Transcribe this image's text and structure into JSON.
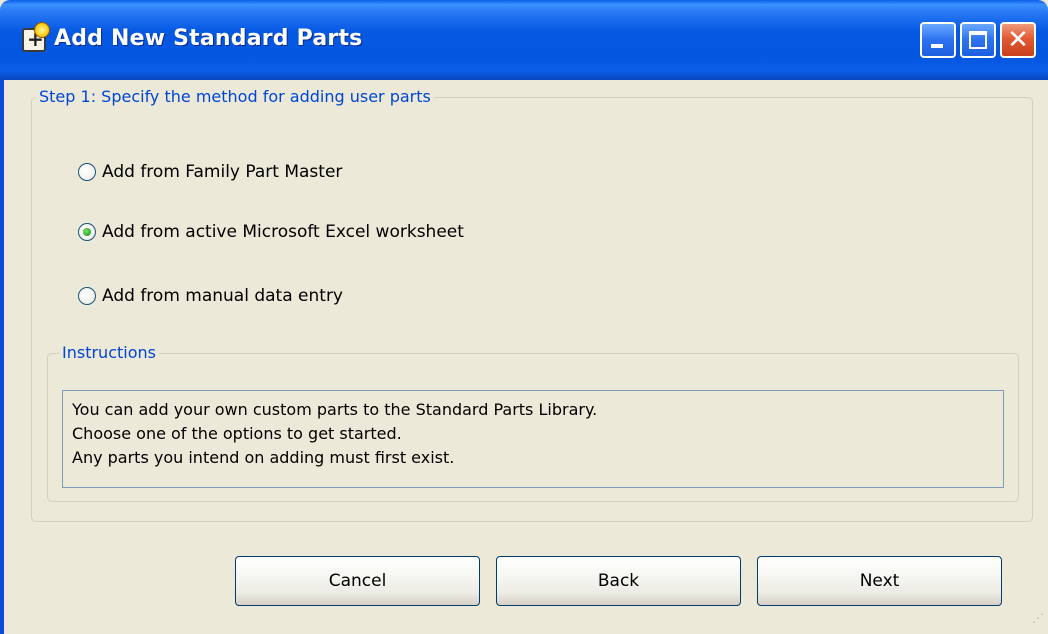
{
  "window": {
    "title": "Add New Standard Parts",
    "title_icon": "add-part-icon",
    "controls": {
      "minimize_icon": "minimize-icon",
      "maximize_icon": "maximize-icon",
      "close_icon": "close-icon",
      "close_glyph": "✕"
    }
  },
  "step": {
    "legend": "Step 1: Specify the method for adding user parts",
    "options": [
      {
        "label": "Add from Family Part Master",
        "checked": false
      },
      {
        "label": "Add from active Microsoft Excel worksheet",
        "checked": true
      },
      {
        "label": "Add from manual data entry",
        "checked": false
      }
    ]
  },
  "instructions": {
    "legend": "Instructions",
    "lines": [
      "You can add your own custom parts to the Standard Parts Library.",
      "Choose one of the options to get started.",
      "Any parts you intend on adding must first exist."
    ]
  },
  "buttons": {
    "cancel": "Cancel",
    "back": "Back",
    "next": "Next"
  },
  "colors": {
    "titlebar": "#0356df",
    "legend_text": "#0046d5",
    "window_bg": "#ece9d8",
    "close_button": "#e25a33"
  }
}
